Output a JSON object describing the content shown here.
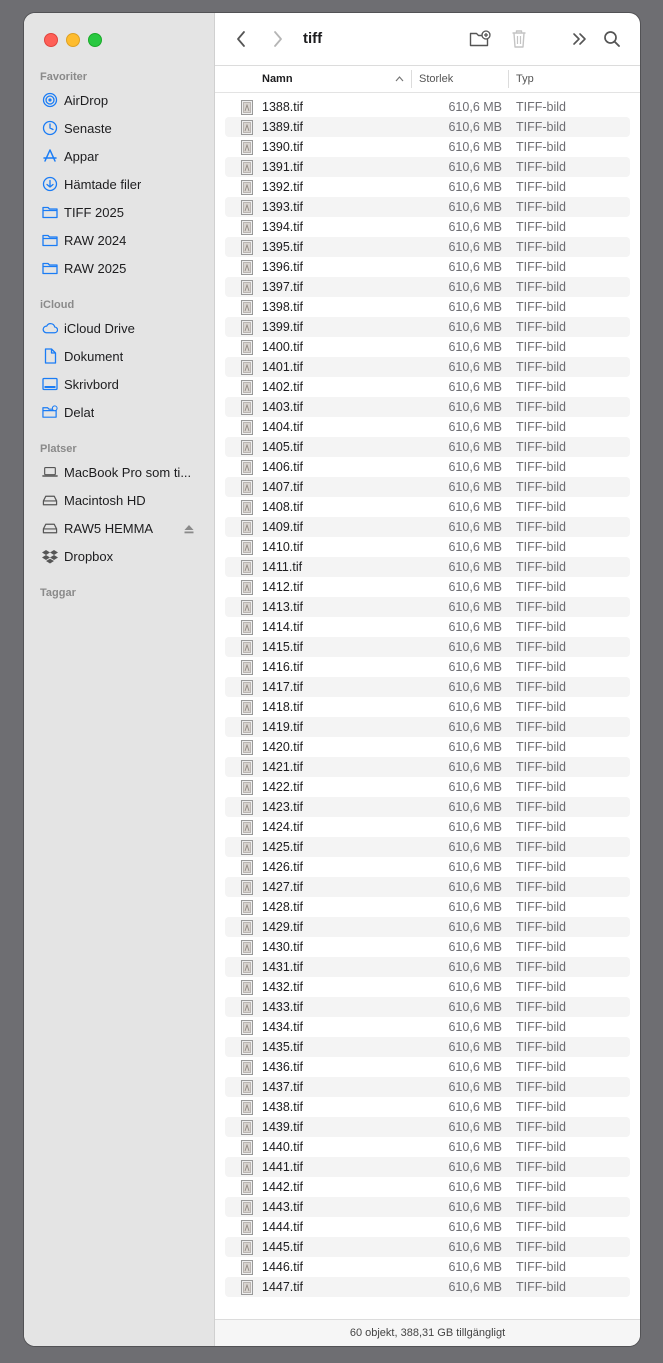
{
  "window": {
    "title": "tiff"
  },
  "sidebar": {
    "sections": [
      {
        "title": "Favoriter",
        "items": [
          {
            "label": "AirDrop",
            "icon": "airdrop-icon"
          },
          {
            "label": "Senaste",
            "icon": "clock-icon"
          },
          {
            "label": "Appar",
            "icon": "apps-icon"
          },
          {
            "label": "Hämtade filer",
            "icon": "download-icon"
          },
          {
            "label": "TIFF 2025",
            "icon": "folder-icon"
          },
          {
            "label": "RAW 2024",
            "icon": "folder-icon"
          },
          {
            "label": "RAW 2025",
            "icon": "folder-icon"
          }
        ]
      },
      {
        "title": "iCloud",
        "items": [
          {
            "label": "iCloud Drive",
            "icon": "cloud-icon"
          },
          {
            "label": "Dokument",
            "icon": "document-icon"
          },
          {
            "label": "Skrivbord",
            "icon": "desktop-icon"
          },
          {
            "label": "Delat",
            "icon": "shared-folder-icon"
          }
        ]
      },
      {
        "title": "Platser",
        "items": [
          {
            "label": "MacBook Pro som ti...",
            "icon": "laptop-icon"
          },
          {
            "label": "Macintosh HD",
            "icon": "drive-icon"
          },
          {
            "label": "RAW5 HEMMA",
            "icon": "drive-icon",
            "eject": true
          },
          {
            "label": "Dropbox",
            "icon": "dropbox-icon"
          }
        ]
      },
      {
        "title": "Taggar",
        "items": []
      }
    ]
  },
  "columns": {
    "name": "Namn",
    "size": "Storlek",
    "type": "Typ"
  },
  "files": {
    "first_number": 1388,
    "count": 60,
    "extension": ".tif",
    "size": "610,6 MB",
    "type": "TIFF-bild"
  },
  "status": {
    "text": "60 objekt, 388,31 GB tillgängligt"
  },
  "colors": {
    "sidebar": "#e4e4e4",
    "accent": "#1a7cf5",
    "alt_row": "#f4f4f4"
  }
}
